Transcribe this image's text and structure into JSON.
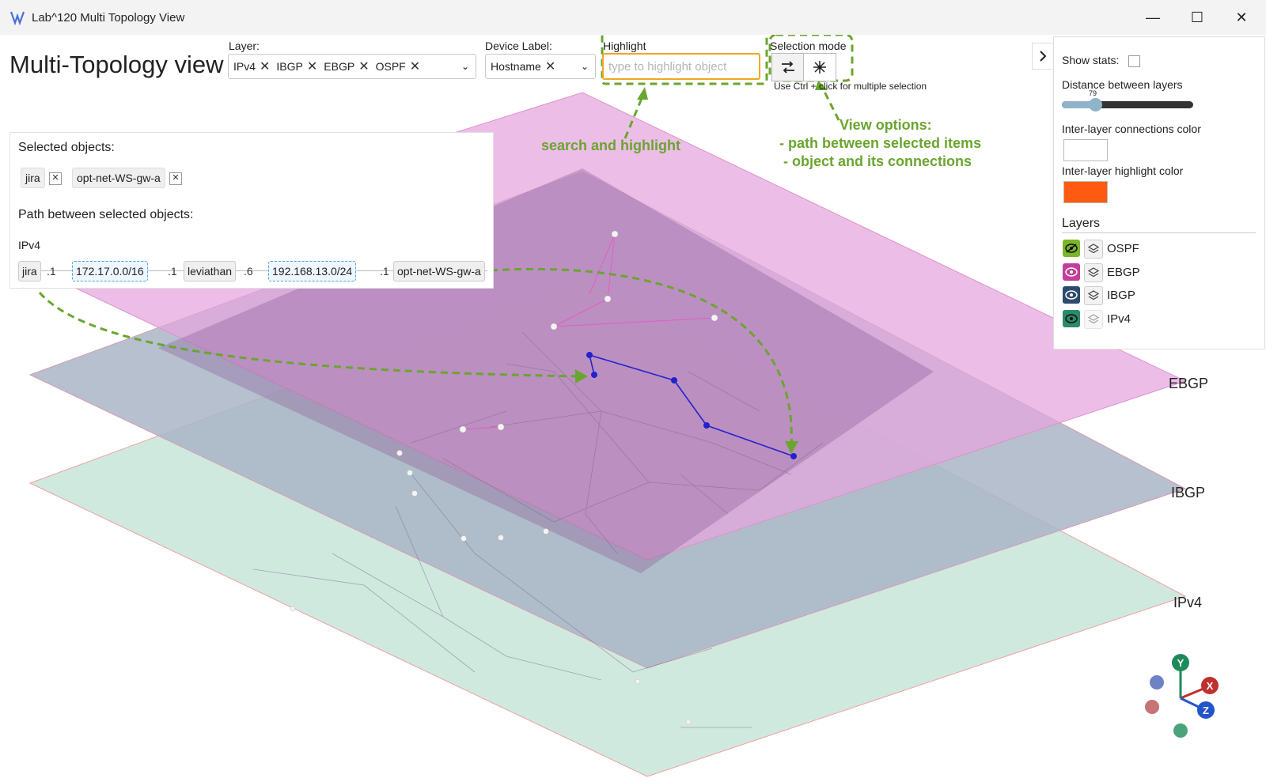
{
  "window": {
    "title": "Lab^120 Multi Topology View",
    "minimize": "—",
    "maximize": "☐",
    "close": "✕"
  },
  "header": {
    "page_title": "Multi-Topology view",
    "layer_label": "Layer:",
    "layer_chips": [
      "IPv4",
      "IBGP",
      "EBGP",
      "OSPF"
    ],
    "device_label_label": "Device Label:",
    "device_label_value": "Hostname",
    "highlight_label": "Highlight",
    "highlight_placeholder": "type to highlight object",
    "selection_mode_label": "Selection mode",
    "selection_hint": "Use Ctrl + click for multiple selection",
    "chip_remove": "✕",
    "caret": "⌄"
  },
  "selected_panel": {
    "heading": "Selected objects:",
    "objects": [
      "jira",
      "opt-net-WS-gw-a"
    ],
    "path_heading": "Path between selected objects:",
    "path_layer": "IPv4",
    "path": [
      {
        "text": "jira",
        "kind": "node"
      },
      {
        "text": ".1",
        "kind": "port"
      },
      {
        "text": "172.17.0.0/16",
        "kind": "net"
      },
      {
        "text": ".1",
        "kind": "port"
      },
      {
        "text": "leviathan",
        "kind": "node"
      },
      {
        "text": ".6",
        "kind": "port"
      },
      {
        "text": "192.168.13.0/24",
        "kind": "net"
      },
      {
        "text": ".1",
        "kind": "port"
      },
      {
        "text": "opt-net-WS-gw-a",
        "kind": "node"
      }
    ]
  },
  "options": {
    "show_stats_label": "Show stats:",
    "distance_label": "Distance between layers",
    "distance_value": "79",
    "distance_fraction": 0.25,
    "interlayer_color_label": "Inter-layer connections color",
    "interlayer_color": "#ffffff",
    "highlight_color_label": "Inter-layer highlight color",
    "highlight_color": "#ff5a12",
    "layers_heading": "Layers",
    "layers": [
      {
        "name": "OSPF",
        "color": "#7ab52a"
      },
      {
        "name": "EBGP",
        "color": "#c2409c"
      },
      {
        "name": "IBGP",
        "color": "#2d4a6f"
      },
      {
        "name": "IPv4",
        "color": "#2a8a6a"
      }
    ]
  },
  "planes": {
    "ebgp": "EBGP",
    "ibgp": "IBGP",
    "ipv4": "IPv4"
  },
  "annotations": {
    "search": "search and highlight",
    "view_title": "View options:",
    "view_line1": "- path between selected items",
    "view_line2": "-  object and its connections"
  },
  "axes": {
    "y": "Y",
    "x": "X",
    "z": "Z"
  },
  "colors": {
    "ospf_plane": "#e4a5de",
    "ebgp_plane": "#a973a8",
    "ibgp_plane": "#a9b5c7",
    "ipv4_plane": "#cfe9df",
    "path_highlight": "#2222cc",
    "annotation": "#6aa52e"
  }
}
